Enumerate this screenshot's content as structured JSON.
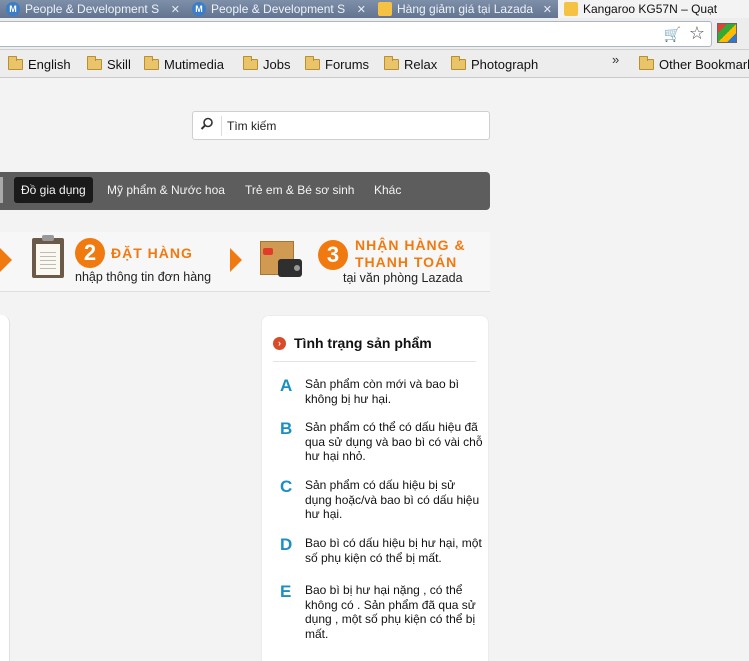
{
  "browser": {
    "tabs": [
      {
        "title": "People & Development S",
        "favicon": "M",
        "kind": "m",
        "active": false
      },
      {
        "title": "People & Development S",
        "favicon": "M",
        "kind": "m",
        "active": false
      },
      {
        "title": "Hàng giảm giá tại Lazada",
        "favicon": "",
        "kind": "laz",
        "active": false
      },
      {
        "title": "Kangaroo KG57N – Quạt",
        "favicon": "",
        "kind": "laz",
        "active": true
      }
    ],
    "close_glyph": "✕",
    "bookmarks": [
      "English",
      "Skill",
      "Mutimedia",
      "Jobs",
      "Forums",
      "Relax",
      "Photograph"
    ],
    "bookmarks_overflow": "»",
    "other_bookmarks": "Other Bookmarks"
  },
  "search": {
    "placeholder": "Tìm kiếm"
  },
  "categories": [
    {
      "label": "Đồ gia dụng",
      "selected": true
    },
    {
      "label": "Mỹ phẩm & Nước hoa",
      "selected": false
    },
    {
      "label": "Trẻ em & Bé sơ sinh",
      "selected": false
    },
    {
      "label": "Khác",
      "selected": false
    }
  ],
  "steps": {
    "step2": {
      "number": "2",
      "title": "ĐẶT HÀNG",
      "subtitle": "nhập thông tin đơn hàng"
    },
    "step3": {
      "number": "3",
      "title_line1": "NHẬN HÀNG &",
      "title_line2": "THANH TOÁN",
      "subtitle": "tại văn phòng Lazada"
    }
  },
  "condition_panel": {
    "title": "Tình trạng sản phẩm",
    "bullet": "›",
    "items": [
      {
        "letter": "A",
        "text": "Sản phẩm còn mới và bao bì không bị hư hại."
      },
      {
        "letter": "B",
        "text": "Sản phẩm có thể có dấu hiệu đã qua sử dụng và bao bì có vài chỗ hư hại nhỏ."
      },
      {
        "letter": "C",
        "text": "Sản phẩm có dấu hiệu bị sử dụng hoặc/và bao bì có dấu hiệu hư hại."
      },
      {
        "letter": "D",
        "text": "Bao bì có dấu hiệu bị hư hại, một số phụ kiện có thể bị mất."
      },
      {
        "letter": "E",
        "text": "Bao bì bị hư hại nặng , có thể không có . Sản phẩm đã qua sử dụng , một số phụ kiện có thể bị mất."
      }
    ]
  },
  "colors": {
    "accent": "#f07a10",
    "letter": "#1a8fc4",
    "nav_bg": "#5d5d5d"
  }
}
